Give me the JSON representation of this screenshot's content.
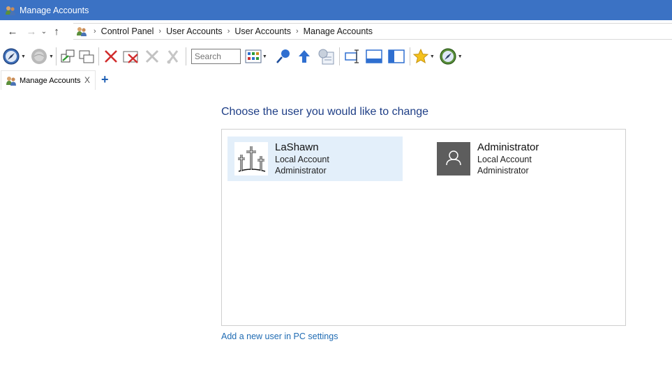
{
  "window": {
    "title": "Manage Accounts"
  },
  "address": {
    "crumbs": [
      "Control Panel",
      "User Accounts",
      "User Accounts",
      "Manage Accounts"
    ]
  },
  "toolbar": {
    "search_placeholder": "Search",
    "icons": [
      "compass-icon",
      "globe-icon",
      "new-window-icon",
      "cascade-windows-icon",
      "delete-x-icon",
      "delete-window-icon",
      "cross-disabled-icon",
      "cut-disabled-icon",
      "view-grid-icon",
      "pushpin-icon",
      "up-arrow-icon",
      "properties-icon",
      "text-select-icon",
      "status-bar-icon",
      "sidebar-icon",
      "favorites-star-icon",
      "compass-dropdown-icon"
    ]
  },
  "tabs": [
    {
      "label": "Manage Accounts",
      "close": "X"
    }
  ],
  "tab_add": "+",
  "main": {
    "heading": "Choose the user you would like to change",
    "accounts": [
      {
        "name": "LaShawn",
        "type": "Local Account",
        "role": "Administrator",
        "selected": true
      },
      {
        "name": "Administrator",
        "type": "Local Account",
        "role": "Administrator",
        "selected": false
      }
    ],
    "add_user_link": "Add a new user in PC settings"
  },
  "colors": {
    "titlebar": "#3b72c4",
    "heading": "#1e3e86",
    "link": "#1f6bb3",
    "selected": "#e3effa"
  }
}
